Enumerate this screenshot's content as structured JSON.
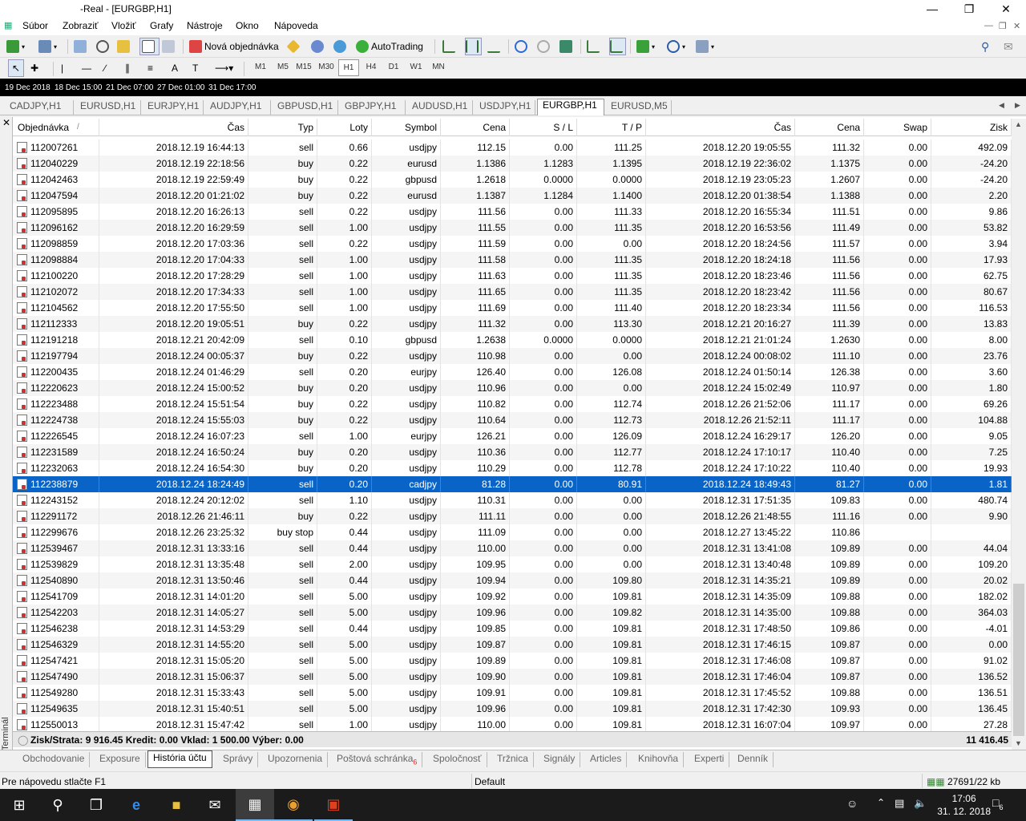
{
  "window": {
    "title": "-Real - [EURGBP,H1]"
  },
  "menu": [
    "Súbor",
    "Zobraziť",
    "Vložiť",
    "Grafy",
    "Nástroje",
    "Okno",
    "Nápoveda"
  ],
  "toolbar": {
    "new_order": "Nová objednávka",
    "autotrading": "AutoTrading",
    "timeframes": [
      "M1",
      "M5",
      "M15",
      "M30",
      "H1",
      "H4",
      "D1",
      "W1",
      "MN"
    ],
    "active_timeframe": "H1"
  },
  "chart_strip": [
    "19 Dec 2018",
    "18 Dec 15:00",
    "21 Dec 07:00",
    "27 Dec 01:00",
    "31 Dec 17:00"
  ],
  "chart_tabs": [
    "CADJPY,H1",
    "EURUSD,H1",
    "EURJPY,H1",
    "AUDJPY,H1",
    "GBPUSD,H1",
    "GBPJPY,H1",
    "AUDUSD,H1",
    "USDJPY,H1",
    "EURGBP,H1",
    "EURUSD,M5"
  ],
  "active_chart_tab": "EURGBP,H1",
  "table": {
    "headers": [
      "Objednávka",
      "Čas",
      "Typ",
      "Loty",
      "Symbol",
      "Cena",
      "S / L",
      "T / P",
      "Čas",
      "Cena",
      "Swap",
      "Zisk"
    ],
    "sort_marker": "/",
    "rows": [
      [
        "112007261",
        "2018.12.19 16:44:13",
        "sell",
        "0.66",
        "usdjpy",
        "112.15",
        "0.00",
        "111.25",
        "2018.12.20 19:05:55",
        "111.32",
        "0.00",
        "492.09"
      ],
      [
        "112040229",
        "2018.12.19 22:18:56",
        "buy",
        "0.22",
        "eurusd",
        "1.1386",
        "1.1283",
        "1.1395",
        "2018.12.19 22:36:02",
        "1.1375",
        "0.00",
        "-24.20"
      ],
      [
        "112042463",
        "2018.12.19 22:59:49",
        "buy",
        "0.22",
        "gbpusd",
        "1.2618",
        "0.0000",
        "0.0000",
        "2018.12.19 23:05:23",
        "1.2607",
        "0.00",
        "-24.20"
      ],
      [
        "112047594",
        "2018.12.20 01:21:02",
        "buy",
        "0.22",
        "eurusd",
        "1.1387",
        "1.1284",
        "1.1400",
        "2018.12.20 01:38:54",
        "1.1388",
        "0.00",
        "2.20"
      ],
      [
        "112095895",
        "2018.12.20 16:26:13",
        "sell",
        "0.22",
        "usdjpy",
        "111.56",
        "0.00",
        "111.33",
        "2018.12.20 16:55:34",
        "111.51",
        "0.00",
        "9.86"
      ],
      [
        "112096162",
        "2018.12.20 16:29:59",
        "sell",
        "1.00",
        "usdjpy",
        "111.55",
        "0.00",
        "111.35",
        "2018.12.20 16:53:56",
        "111.49",
        "0.00",
        "53.82"
      ],
      [
        "112098859",
        "2018.12.20 17:03:36",
        "sell",
        "0.22",
        "usdjpy",
        "111.59",
        "0.00",
        "0.00",
        "2018.12.20 18:24:56",
        "111.57",
        "0.00",
        "3.94"
      ],
      [
        "112098884",
        "2018.12.20 17:04:33",
        "sell",
        "1.00",
        "usdjpy",
        "111.58",
        "0.00",
        "111.35",
        "2018.12.20 18:24:18",
        "111.56",
        "0.00",
        "17.93"
      ],
      [
        "112100220",
        "2018.12.20 17:28:29",
        "sell",
        "1.00",
        "usdjpy",
        "111.63",
        "0.00",
        "111.35",
        "2018.12.20 18:23:46",
        "111.56",
        "0.00",
        "62.75"
      ],
      [
        "112102072",
        "2018.12.20 17:34:33",
        "sell",
        "1.00",
        "usdjpy",
        "111.65",
        "0.00",
        "111.35",
        "2018.12.20 18:23:42",
        "111.56",
        "0.00",
        "80.67"
      ],
      [
        "112104562",
        "2018.12.20 17:55:50",
        "sell",
        "1.00",
        "usdjpy",
        "111.69",
        "0.00",
        "111.40",
        "2018.12.20 18:23:34",
        "111.56",
        "0.00",
        "116.53"
      ],
      [
        "112112333",
        "2018.12.20 19:05:51",
        "buy",
        "0.22",
        "usdjpy",
        "111.32",
        "0.00",
        "113.30",
        "2018.12.21 20:16:27",
        "111.39",
        "0.00",
        "13.83"
      ],
      [
        "112191218",
        "2018.12.21 20:42:09",
        "sell",
        "0.10",
        "gbpusd",
        "1.2638",
        "0.0000",
        "0.0000",
        "2018.12.21 21:01:24",
        "1.2630",
        "0.00",
        "8.00"
      ],
      [
        "112197794",
        "2018.12.24 00:05:37",
        "buy",
        "0.22",
        "usdjpy",
        "110.98",
        "0.00",
        "0.00",
        "2018.12.24 00:08:02",
        "111.10",
        "0.00",
        "23.76"
      ],
      [
        "112200435",
        "2018.12.24 01:46:29",
        "sell",
        "0.20",
        "eurjpy",
        "126.40",
        "0.00",
        "126.08",
        "2018.12.24 01:50:14",
        "126.38",
        "0.00",
        "3.60"
      ],
      [
        "112220623",
        "2018.12.24 15:00:52",
        "buy",
        "0.20",
        "usdjpy",
        "110.96",
        "0.00",
        "0.00",
        "2018.12.24 15:02:49",
        "110.97",
        "0.00",
        "1.80"
      ],
      [
        "112223488",
        "2018.12.24 15:51:54",
        "buy",
        "0.22",
        "usdjpy",
        "110.82",
        "0.00",
        "112.74",
        "2018.12.26 21:52:06",
        "111.17",
        "0.00",
        "69.26"
      ],
      [
        "112224738",
        "2018.12.24 15:55:03",
        "buy",
        "0.22",
        "usdjpy",
        "110.64",
        "0.00",
        "112.73",
        "2018.12.26 21:52:11",
        "111.17",
        "0.00",
        "104.88"
      ],
      [
        "112226545",
        "2018.12.24 16:07:23",
        "sell",
        "1.00",
        "eurjpy",
        "126.21",
        "0.00",
        "126.09",
        "2018.12.24 16:29:17",
        "126.20",
        "0.00",
        "9.05"
      ],
      [
        "112231589",
        "2018.12.24 16:50:24",
        "buy",
        "0.20",
        "usdjpy",
        "110.36",
        "0.00",
        "112.77",
        "2018.12.24 17:10:17",
        "110.40",
        "0.00",
        "7.25"
      ],
      [
        "112232063",
        "2018.12.24 16:54:30",
        "buy",
        "0.20",
        "usdjpy",
        "110.29",
        "0.00",
        "112.78",
        "2018.12.24 17:10:22",
        "110.40",
        "0.00",
        "19.93"
      ],
      [
        "112238879",
        "2018.12.24 18:24:49",
        "sell",
        "0.20",
        "cadjpy",
        "81.28",
        "0.00",
        "80.91",
        "2018.12.24 18:49:43",
        "81.27",
        "0.00",
        "1.81"
      ],
      [
        "112243152",
        "2018.12.24 20:12:02",
        "sell",
        "1.10",
        "usdjpy",
        "110.31",
        "0.00",
        "0.00",
        "2018.12.31 17:51:35",
        "109.83",
        "0.00",
        "480.74"
      ],
      [
        "112291172",
        "2018.12.26 21:46:11",
        "buy",
        "0.22",
        "usdjpy",
        "111.11",
        "0.00",
        "0.00",
        "2018.12.26 21:48:55",
        "111.16",
        "0.00",
        "9.90"
      ],
      [
        "112299676",
        "2018.12.26 23:25:32",
        "buy stop",
        "0.44",
        "usdjpy",
        "111.09",
        "0.00",
        "0.00",
        "2018.12.27 13:45:22",
        "110.86",
        "",
        ""
      ],
      [
        "112539467",
        "2018.12.31 13:33:16",
        "sell",
        "0.44",
        "usdjpy",
        "110.00",
        "0.00",
        "0.00",
        "2018.12.31 13:41:08",
        "109.89",
        "0.00",
        "44.04"
      ],
      [
        "112539829",
        "2018.12.31 13:35:48",
        "sell",
        "2.00",
        "usdjpy",
        "109.95",
        "0.00",
        "0.00",
        "2018.12.31 13:40:48",
        "109.89",
        "0.00",
        "109.20"
      ],
      [
        "112540890",
        "2018.12.31 13:50:46",
        "sell",
        "0.44",
        "usdjpy",
        "109.94",
        "0.00",
        "109.80",
        "2018.12.31 14:35:21",
        "109.89",
        "0.00",
        "20.02"
      ],
      [
        "112541709",
        "2018.12.31 14:01:20",
        "sell",
        "5.00",
        "usdjpy",
        "109.92",
        "0.00",
        "109.81",
        "2018.12.31 14:35:09",
        "109.88",
        "0.00",
        "182.02"
      ],
      [
        "112542203",
        "2018.12.31 14:05:27",
        "sell",
        "5.00",
        "usdjpy",
        "109.96",
        "0.00",
        "109.82",
        "2018.12.31 14:35:00",
        "109.88",
        "0.00",
        "364.03"
      ],
      [
        "112546238",
        "2018.12.31 14:53:29",
        "sell",
        "0.44",
        "usdjpy",
        "109.85",
        "0.00",
        "109.81",
        "2018.12.31 17:48:50",
        "109.86",
        "0.00",
        "-4.01"
      ],
      [
        "112546329",
        "2018.12.31 14:55:20",
        "sell",
        "5.00",
        "usdjpy",
        "109.87",
        "0.00",
        "109.81",
        "2018.12.31 17:46:15",
        "109.87",
        "0.00",
        "0.00"
      ],
      [
        "112547421",
        "2018.12.31 15:05:20",
        "sell",
        "5.00",
        "usdjpy",
        "109.89",
        "0.00",
        "109.81",
        "2018.12.31 17:46:08",
        "109.87",
        "0.00",
        "91.02"
      ],
      [
        "112547490",
        "2018.12.31 15:06:37",
        "sell",
        "5.00",
        "usdjpy",
        "109.90",
        "0.00",
        "109.81",
        "2018.12.31 17:46:04",
        "109.87",
        "0.00",
        "136.52"
      ],
      [
        "112549280",
        "2018.12.31 15:33:43",
        "sell",
        "5.00",
        "usdjpy",
        "109.91",
        "0.00",
        "109.81",
        "2018.12.31 17:45:52",
        "109.88",
        "0.00",
        "136.51"
      ],
      [
        "112549635",
        "2018.12.31 15:40:51",
        "sell",
        "5.00",
        "usdjpy",
        "109.96",
        "0.00",
        "109.81",
        "2018.12.31 17:42:30",
        "109.93",
        "0.00",
        "136.45"
      ],
      [
        "112550013",
        "2018.12.31 15:47:42",
        "sell",
        "1.00",
        "usdjpy",
        "110.00",
        "0.00",
        "109.81",
        "2018.12.31 16:07:04",
        "109.97",
        "0.00",
        "27.28"
      ]
    ],
    "selected_index": 21
  },
  "summary": {
    "text": "Zisk/Strata: 9 916.45  Kredit: 0.00  Vklad: 1 500.00  Výber: 0.00",
    "total": "11 416.45"
  },
  "terminal_label": "Terminál",
  "bottom_tabs": [
    "Obchodovanie",
    "Exposure",
    "História účtu",
    "Správy",
    "Upozornenia",
    "Poštová schránka",
    "Spoločnosť",
    "Tržnica",
    "Signály",
    "Articles",
    "Knihovňa",
    "Experti",
    "Denník"
  ],
  "mailbox_badge": "6",
  "active_bottom_tab": "História účtu",
  "status": {
    "help": "Pre nápovedu stlačte F1",
    "profile": "Default",
    "traffic": "27691/22 kb"
  },
  "taskbar": {
    "time": "17:06",
    "date": "31. 12. 2018",
    "notifications": "6"
  },
  "colors": {
    "selection": "#0a64c8",
    "loss_icon": "#d23030"
  }
}
